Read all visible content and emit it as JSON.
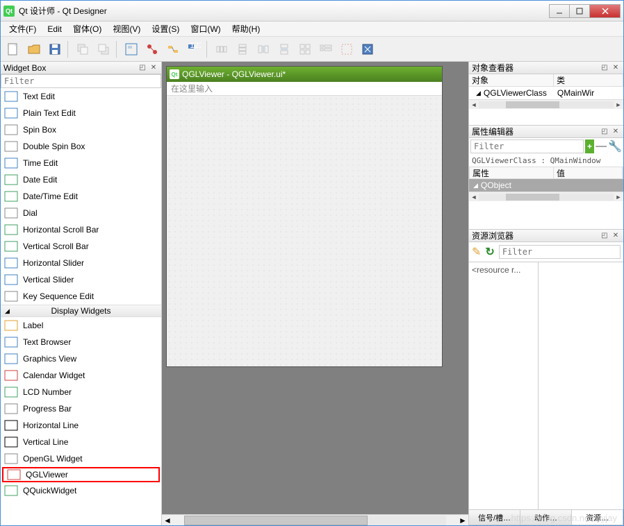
{
  "window": {
    "title": "Qt 设计师 - Qt Designer"
  },
  "menubar": [
    "文件(F)",
    "Edit",
    "窗体(O)",
    "视图(V)",
    "设置(S)",
    "窗口(W)",
    "帮助(H)"
  ],
  "widgetbox": {
    "title": "Widget Box",
    "filter_placeholder": "Filter",
    "edit_widgets": [
      "Text Edit",
      "Plain Text Edit",
      "Spin Box",
      "Double Spin Box",
      "Time Edit",
      "Date Edit",
      "Date/Time Edit",
      "Dial",
      "Horizontal Scroll Bar",
      "Vertical Scroll Bar",
      "Horizontal Slider",
      "Vertical Slider",
      "Key Sequence Edit"
    ],
    "category_label": "Display Widgets",
    "display_widgets": [
      "Label",
      "Text Browser",
      "Graphics View",
      "Calendar Widget",
      "LCD Number",
      "Progress Bar",
      "Horizontal Line",
      "Vertical Line",
      "OpenGL Widget",
      "QGLViewer",
      "QQuickWidget"
    ]
  },
  "form": {
    "title": "QGLViewer - QGLViewer.ui*",
    "menu_hint": "在这里输入"
  },
  "object_inspector": {
    "title": "对象查看器",
    "col_object": "对象",
    "col_class": "类",
    "row_object": "QGLViewerClass",
    "row_class": "QMainWir"
  },
  "property_editor": {
    "title": "属性编辑器",
    "filter_placeholder": "Filter",
    "class_line": "QGLViewerClass : QMainWindow",
    "col_prop": "属性",
    "col_value": "值",
    "group": "QObject"
  },
  "resource_browser": {
    "title": "资源浏览器",
    "filter_placeholder": "Filter",
    "placeholder": "<resource r..."
  },
  "bottom_tabs": {
    "signals": "信号/槽…",
    "actions": "动作…",
    "resources": "资源…"
  },
  "watermark": "https://blog.csdn.net/lyyjay"
}
